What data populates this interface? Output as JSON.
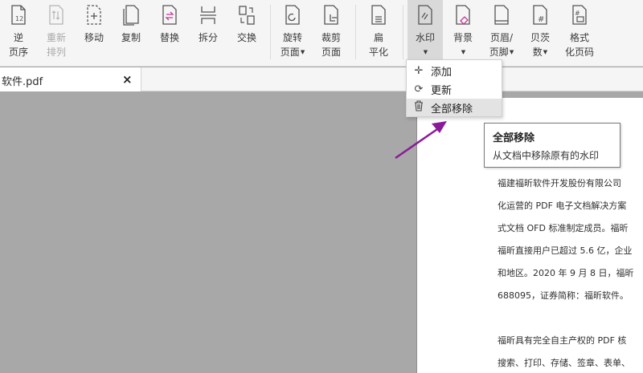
{
  "ribbon": {
    "tools": [
      {
        "label": "逆\n页序",
        "icon": "reverse-pages-icon"
      },
      {
        "label": "重新\n排列",
        "icon": "rearrange-icon",
        "disabled": true
      },
      {
        "label": "移动",
        "icon": "move-icon"
      },
      {
        "label": "复制",
        "icon": "copy-icon"
      },
      {
        "label": "替换",
        "icon": "replace-icon"
      },
      {
        "label": "拆分",
        "icon": "split-icon"
      },
      {
        "label": "交换",
        "icon": "swap-icon"
      },
      {
        "label": "旋转\n页面",
        "icon": "rotate-page-icon"
      },
      {
        "label": "裁剪\n页面",
        "icon": "crop-page-icon"
      },
      {
        "label": "扁\n平化",
        "icon": "flatten-icon"
      },
      {
        "label": "水印",
        "icon": "watermark-icon"
      },
      {
        "label": "背景",
        "icon": "background-icon"
      },
      {
        "label": "页眉/\n页脚",
        "icon": "header-footer-icon"
      },
      {
        "label": "贝茨\n数",
        "icon": "bates-number-icon"
      },
      {
        "label": "格式\n化页码",
        "icon": "format-page-number-icon"
      }
    ]
  },
  "tab": {
    "file_name": "软件.pdf",
    "close_glyph": "×"
  },
  "watermark_menu": {
    "items": [
      {
        "icon_glyph": "✛",
        "label": "添加"
      },
      {
        "icon_glyph": "⟳",
        "label": "更新"
      },
      {
        "icon_glyph": "🗑",
        "label": "全部移除"
      }
    ]
  },
  "tooltip": {
    "title": "全部移除",
    "description": "从文档中移除原有的水印"
  },
  "document": {
    "lines": [
      "福建福昕软件开发股份有限公司",
      "化运营的 PDF 电子文档解决方案",
      "式文档 OFD 标准制定成员。福昕",
      "福昕直接用户已超过 5.6 亿，企业",
      "和地区。2020 年 9 月 8 日，福昕",
      "688095，证券简称：福昕软件。",
      "",
      "福昕具有完全自主产权的 PDF 核",
      "搜索、打印、存储、签章、表单、"
    ]
  },
  "colors": {
    "annotation_arrow": "#8b1a9a",
    "menu_hover": "#e3e3e3",
    "ribbon_bg": "#f5f5f5",
    "workspace_bg": "#a8a8a8"
  }
}
